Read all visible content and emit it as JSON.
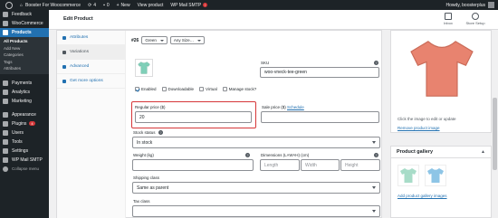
{
  "adminbar": {
    "site_name": "Booster For Woocommerce",
    "updates_count": "4",
    "comments_count": "0",
    "new_label": "New",
    "view_product": "View product",
    "smtp_label": "WP Mail SMTP",
    "smtp_badge": "!",
    "greeting": "Howdy, boosterplus"
  },
  "sidebar": {
    "items": [
      {
        "label": "Feedback",
        "icon": "feedback-icon"
      },
      {
        "label": "WooCommerce",
        "icon": "woocommerce-icon"
      },
      {
        "label": "Products",
        "icon": "products-icon",
        "active": true
      }
    ],
    "submenu": [
      "All Products",
      "Add New",
      "Categories",
      "Tags",
      "Attributes"
    ],
    "items_after": [
      {
        "label": "Payments",
        "icon": "payments-icon"
      },
      {
        "label": "Analytics",
        "icon": "analytics-icon"
      },
      {
        "label": "Marketing",
        "icon": "marketing-icon"
      },
      {
        "label": "Appearance",
        "icon": "appearance-icon"
      },
      {
        "label": "Plugins",
        "icon": "plugins-icon",
        "badge": "4"
      },
      {
        "label": "Users",
        "icon": "users-icon"
      },
      {
        "label": "Tools",
        "icon": "tools-icon"
      },
      {
        "label": "Settings",
        "icon": "settings-icon"
      },
      {
        "label": "WP Mail SMTP",
        "icon": "mail-icon"
      },
      {
        "label": "Collapse menu",
        "icon": "collapse-icon"
      }
    ]
  },
  "header": {
    "title": "Edit Product",
    "inbox": "Inbox",
    "store_setup": "Store Setup"
  },
  "tabs": [
    {
      "label": "Attributes",
      "active": false
    },
    {
      "label": "Variations",
      "active": true
    },
    {
      "label": "Advanced",
      "active": false
    },
    {
      "label": "Get more options",
      "active": false
    }
  ],
  "variation": {
    "id": "#26",
    "color": "Green",
    "size": "Any Size…",
    "sku_label": "SKU",
    "sku_value": "woo-vneck-tee-green",
    "checkboxes": [
      {
        "label": "Enabled",
        "checked": true
      },
      {
        "label": "Downloadable",
        "checked": false
      },
      {
        "label": "Virtual",
        "checked": false
      },
      {
        "label": "Manage stock?",
        "checked": false
      }
    ],
    "regular_price_label": "Regular price ($)",
    "regular_price_value": "20",
    "sale_price_label": "Sale price ($)",
    "schedule_link": "Schedule",
    "stock_status_label": "Stock status",
    "stock_status_value": "In stock",
    "weight_label": "Weight (kg)",
    "dimensions_label": "Dimensions (L×W×H) (cm)",
    "length_placeholder": "Length",
    "width_placeholder": "Width",
    "height_placeholder": "Height",
    "shipping_class_label": "Shipping class",
    "shipping_class_value": "Same as parent",
    "tax_class_label": "Tax class"
  },
  "product_image": {
    "hint": "Click the image to edit or update",
    "remove_link": "Remove product image"
  },
  "gallery": {
    "title": "Product gallery",
    "add_link": "Add product gallery images"
  },
  "colors": {
    "accent": "#2271b1",
    "shirt": "#e8836f",
    "highlight": "#d63638"
  }
}
